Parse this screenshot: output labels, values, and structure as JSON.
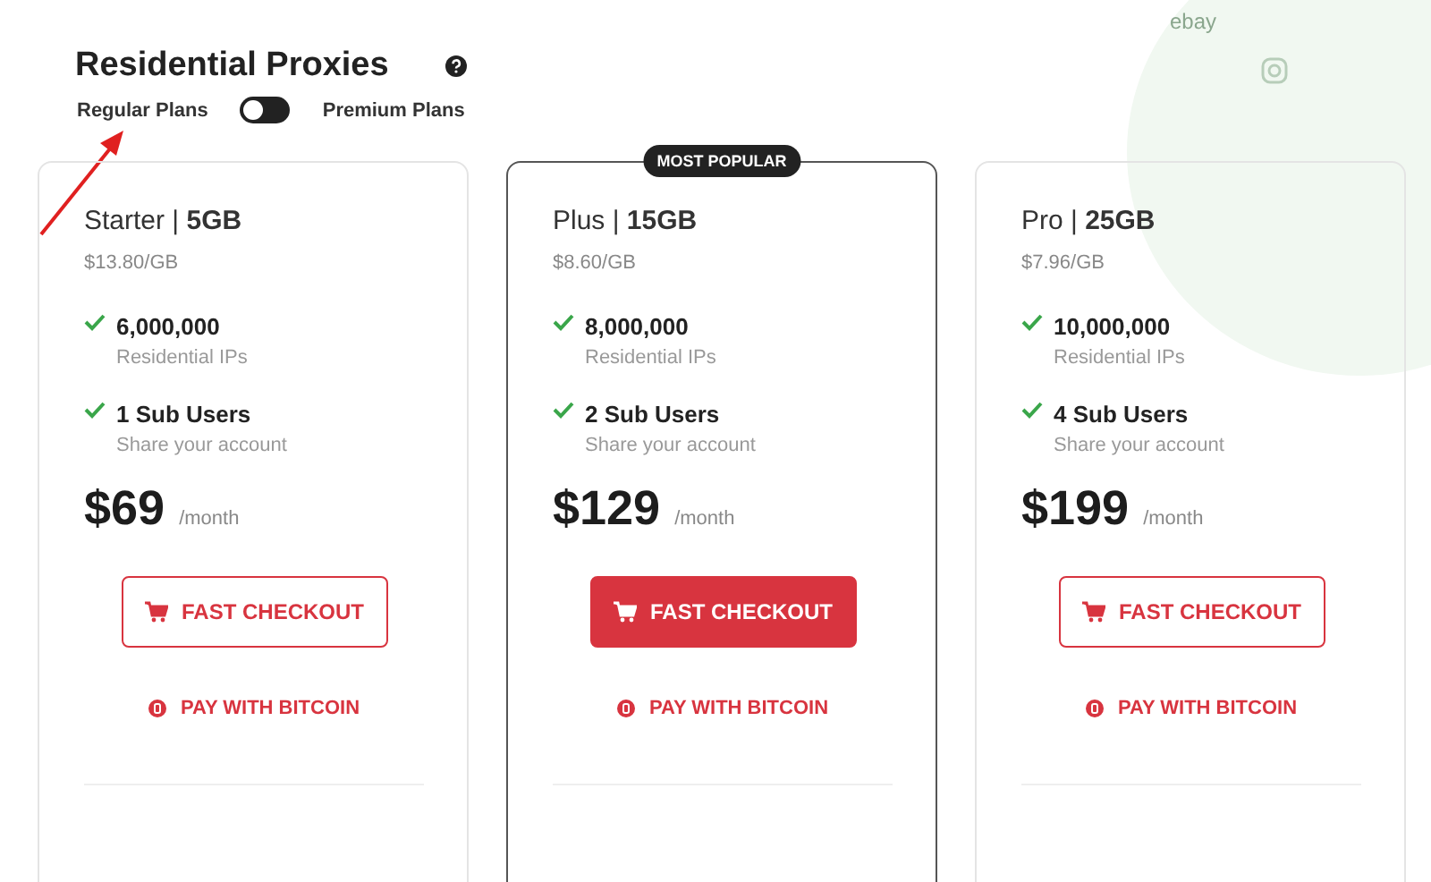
{
  "header": {
    "title": "Residential Proxies",
    "toggle": {
      "left_label": "Regular Plans",
      "right_label": "Premium Plans",
      "on": false
    }
  },
  "background": {
    "logo_text": "ebay"
  },
  "plans": [
    {
      "name": "Starter | **5GB**",
      "per_gb": "$13.80/GB",
      "selected": false,
      "features": [
        {
          "title": "6,000,000",
          "subtitle": "Residential IPs"
        },
        {
          "title": "1 Sub Users",
          "subtitle": "Share your account"
        }
      ],
      "price": "$69",
      "period": "/month",
      "checkout": "FAST CHECKOUT",
      "bitcoin": "PAY WITH BITCOIN"
    },
    {
      "name": "Plus | **15GB**",
      "per_gb": "$8.60/GB",
      "selected": true,
      "badge": "MOST POPULAR",
      "features": [
        {
          "title": "8,000,000",
          "subtitle": "Residential IPs"
        },
        {
          "title": "2 Sub Users",
          "subtitle": "Share your account"
        }
      ],
      "price": "$129",
      "period": "/month",
      "checkout": "FAST CHECKOUT",
      "bitcoin": "PAY WITH BITCOIN"
    },
    {
      "name": "Pro | **25GB**",
      "per_gb": "$7.96/GB",
      "selected": false,
      "features": [
        {
          "title": "10,000,000",
          "subtitle": "Residential IPs"
        },
        {
          "title": "4 Sub Users",
          "subtitle": "Share your account"
        }
      ],
      "price": "$199",
      "period": "/month",
      "checkout": "FAST CHECKOUT",
      "bitcoin": "PAY WITH BITCOIN"
    }
  ]
}
